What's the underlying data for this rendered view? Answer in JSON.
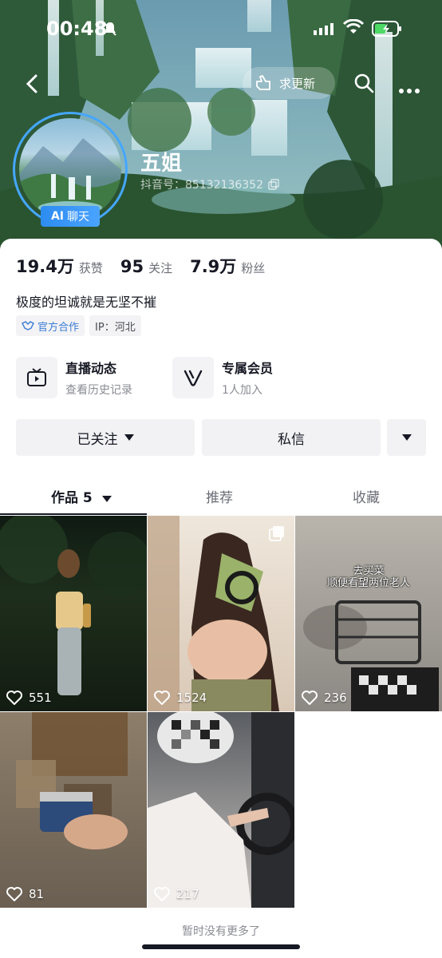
{
  "status_bar": {
    "time": "00:48"
  },
  "nav": {
    "update_label": "求更新"
  },
  "profile": {
    "ai_badge": "AI",
    "ai_badge_sub": "聊天",
    "nickname": "五姐",
    "account_id": "抖音号：85132136352",
    "bio": "极度的坦诚就是无坚不摧"
  },
  "stats": [
    {
      "num": "19.4万",
      "label": "获赞"
    },
    {
      "num": "95",
      "label": "关注"
    },
    {
      "num": "7.9万",
      "label": "粉丝"
    }
  ],
  "tags": {
    "official": "官方合作",
    "ip": "IP：河北"
  },
  "features": [
    {
      "title": "直播动态",
      "sub": "查看历史记录",
      "icon": "tv-icon"
    },
    {
      "title": "专属会员",
      "sub": "1人加入",
      "icon": "v-icon"
    }
  ],
  "actions": {
    "following": "已关注",
    "message": "私信"
  },
  "tabs": {
    "works": "作品 5",
    "recommend": "推荐",
    "favorites": "收藏"
  },
  "posts": [
    {
      "likes": "551"
    },
    {
      "likes": "1524"
    },
    {
      "likes": "236",
      "caption_line1": "去买菜",
      "caption_line2": "顺便看望两位老人"
    },
    {
      "likes": "81"
    },
    {
      "likes": "217"
    }
  ],
  "footer": {
    "note": "暂时没有更多了"
  },
  "colors": {
    "accent": "#45a7ff",
    "official": "#3a7bd5"
  }
}
